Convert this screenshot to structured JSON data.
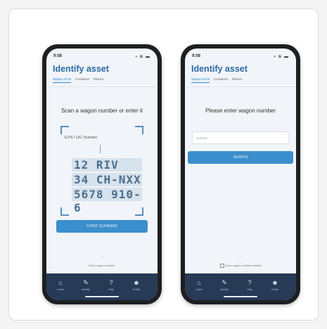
{
  "phone_left": {
    "status": {
      "time": "9:08",
      "icons": "▪ ≋ ▬"
    },
    "title": "Identify asset",
    "tabs": [
      "Wagon EVN",
      "Container",
      "Places"
    ],
    "prompt": "Scan a wagon number or enter it",
    "input_label": "EVN / UIC Number",
    "plate_lines": [
      "12 RIV",
      "34 CH-NXX",
      "5678 910-6"
    ],
    "button_label": "START SCANNING",
    "small_text_1": "—",
    "small_text_2": "Enter wagon number",
    "nav": [
      {
        "icon": "⌂",
        "label": "Home"
      },
      {
        "icon": "✎",
        "label": "Identify"
      },
      {
        "icon": "?",
        "label": "Help"
      },
      {
        "icon": "☻",
        "label": "Profile"
      }
    ]
  },
  "phone_right": {
    "status": {
      "time": "9:08",
      "icons": "▪ ≋ ▬"
    },
    "title": "Identify asset",
    "tabs": [
      "Wagon EVN",
      "Container",
      "Places"
    ],
    "prompt": "Please enter wagon number",
    "field_placeholder": "Number",
    "button_label": "SEARCH",
    "small_text_1": "—",
    "small_text_2": "Scan wagon number instead",
    "nav": [
      {
        "icon": "⌂",
        "label": "Home"
      },
      {
        "icon": "✎",
        "label": "Identify"
      },
      {
        "icon": "?",
        "label": "Help"
      },
      {
        "icon": "☻",
        "label": "Profile"
      }
    ]
  },
  "colors": {
    "accent": "#3a8fcc",
    "title": "#2b6aa3",
    "navbar": "#273a56",
    "plate_bg": "#d6e2ec"
  }
}
